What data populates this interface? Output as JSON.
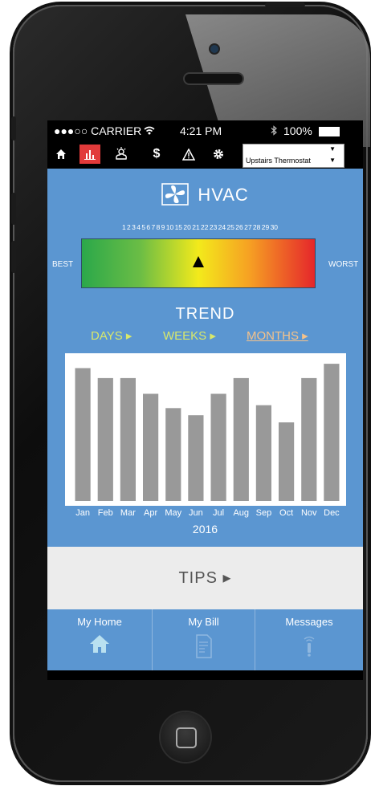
{
  "status_bar": {
    "carrier": "●●●○○ CARRIER",
    "wifi_icon": "wifi-icon",
    "time": "4:21 PM",
    "bluetooth_icon": "bluetooth-icon",
    "battery": "100%"
  },
  "toolbar": {
    "icons": [
      "home-icon",
      "usage-chart-icon",
      "weather-icon",
      "dollar-icon",
      "alert-icon",
      "gear-icon"
    ],
    "active_index": 1,
    "thermostat_select": "Upstairs Thermostat"
  },
  "hvac": {
    "title": "HVAC",
    "scale_numbers": "1 2 3 4 5 6 7 8 9 10 15 20 21 22 23 24 25 26 27 28 29 30",
    "best_label": "BEST",
    "worst_label": "WORST",
    "marker_position": 0.5
  },
  "trend": {
    "title": "TREND",
    "tabs": [
      {
        "label": "DAYS ▸",
        "color": "#d9e86a",
        "active": false
      },
      {
        "label": "WEEKS ▸",
        "color": "#d9e86a",
        "active": false
      },
      {
        "label": "MONTHS ▸",
        "color": "#f5c28a",
        "active": true
      }
    ],
    "year": "2016"
  },
  "chart_data": {
    "type": "bar",
    "categories": [
      "Jan",
      "Feb",
      "Mar",
      "Apr",
      "May",
      "Jun",
      "Jul",
      "Aug",
      "Sep",
      "Oct",
      "Nov",
      "Dec"
    ],
    "values": [
      93,
      86,
      86,
      75,
      65,
      60,
      75,
      86,
      67,
      55,
      86,
      96
    ],
    "ylim": [
      0,
      100
    ],
    "grid": false,
    "bar_color": "#999999"
  },
  "tips": {
    "label": "TIPS ▸"
  },
  "bottom_nav": [
    {
      "label": "My Home",
      "icon": "house-icon"
    },
    {
      "label": "My Bill",
      "icon": "bill-document-icon"
    },
    {
      "label": "Messages",
      "icon": "message-signal-icon"
    }
  ],
  "colors": {
    "accent": "#5b96d1",
    "active_icon_bg": "#e23a3a"
  }
}
